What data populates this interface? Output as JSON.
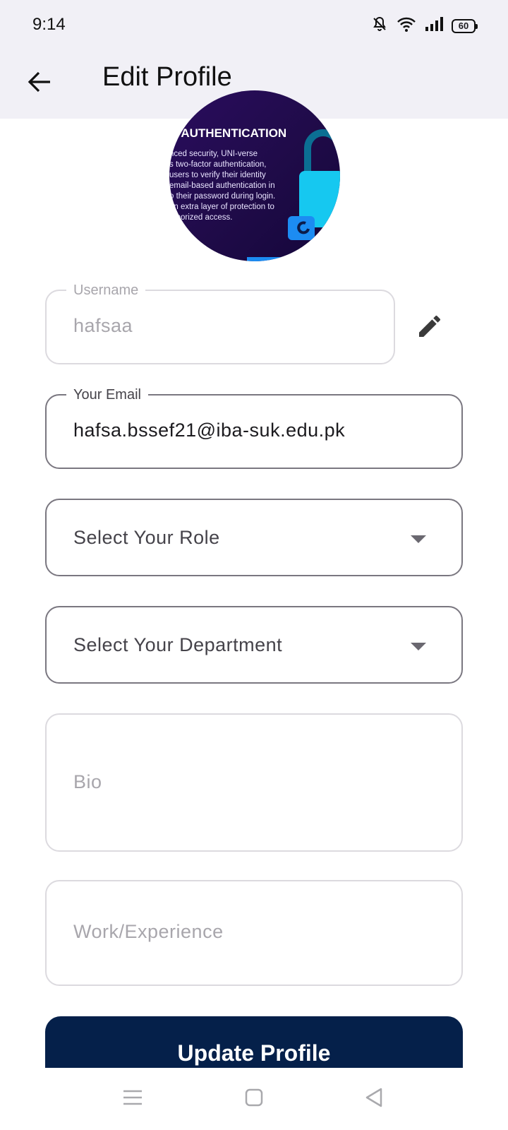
{
  "status_bar": {
    "time": "9:14",
    "battery": "60",
    "icons": [
      "mute-bell-icon",
      "wifi-icon",
      "signal-icon",
      "battery-icon"
    ]
  },
  "app_bar": {
    "title": "Edit Profile",
    "back_icon": "arrow-back-icon"
  },
  "avatar": {
    "heading": "R AUTHENTICATION",
    "lines": [
      "nced security, UNI-verse",
      "s two-factor authentication,",
      " users to verify their identity",
      "email-based authentication in",
      "o their password during login.",
      "an extra layer of protection to",
      "uthorized access."
    ]
  },
  "form": {
    "username": {
      "label": "Username",
      "value": "hafsaa",
      "edit_icon": "pencil-icon"
    },
    "email": {
      "label": "Your Email",
      "value": "hafsa.bssef21@iba-suk.edu.pk"
    },
    "role": {
      "placeholder": "Select Your Role"
    },
    "department": {
      "placeholder": "Select Your Department"
    },
    "bio": {
      "placeholder": "Bio"
    },
    "work": {
      "placeholder": "Work/Experience"
    }
  },
  "update_button": {
    "label": "Update Profile"
  },
  "nav_bar": {
    "icons": [
      "menu-icon",
      "home-square-icon",
      "back-triangle-icon"
    ]
  },
  "colors": {
    "primary_button": "#05204a",
    "app_bar_bg": "#f1f0f6",
    "outline": "#7a7780",
    "outline_light": "#dcdadf"
  }
}
